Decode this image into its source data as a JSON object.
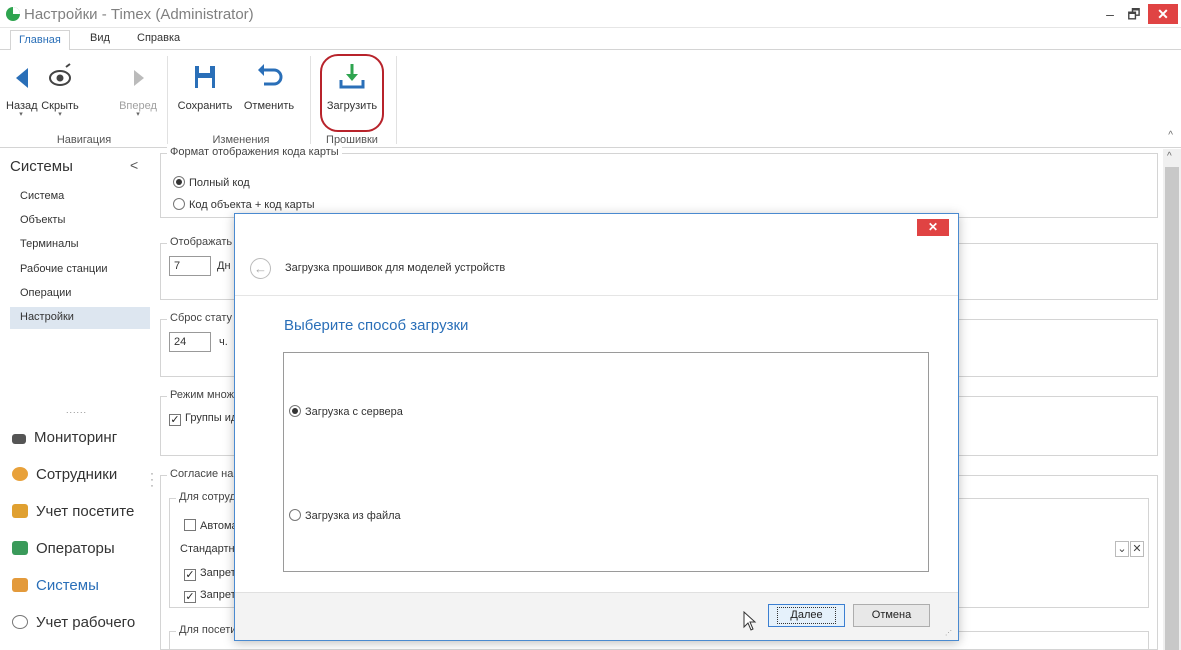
{
  "window": {
    "title": "Настройки - Timex (Administrator)"
  },
  "ribbon_tabs": [
    "Главная",
    "Вид",
    "Справка"
  ],
  "ribbon": {
    "nav": {
      "back": "Назад",
      "hide": "Скрыть",
      "forward": "Вперед",
      "group": "Навигация"
    },
    "changes": {
      "save": "Сохранить",
      "undo": "Отменить",
      "group": "Изменения"
    },
    "firmware": {
      "load": "Загрузить",
      "group": "Прошивки"
    }
  },
  "sidebar": {
    "header": "Системы",
    "items": [
      "Система",
      "Объекты",
      "Терминалы",
      "Рабочие станции",
      "Операции",
      "Настройки"
    ],
    "selected": "Настройки",
    "sections": [
      "Мониторинг",
      "Сотрудники",
      "Учет посетите",
      "Операторы",
      "Системы",
      "Учет рабочего"
    ]
  },
  "main": {
    "card_format": {
      "title": "Формат отображения кода карты",
      "full_code": "Полный код",
      "object_plus_card": "Код объекта + код карты"
    },
    "display": {
      "title": "Отображать",
      "value": "7",
      "unit": "Дн"
    },
    "reset": {
      "title": "Сброс стату",
      "value": "24",
      "unit": "ч."
    },
    "mode": {
      "title": "Режим множ",
      "groups": "Группы ид"
    },
    "consent": {
      "title": "Согласие на",
      "employees": "Для сотруд",
      "auto": "Автомат",
      "standard": "Стандартн",
      "ban1": "Запрет",
      "ban2": "Запрет",
      "visitors": "Для посети"
    }
  },
  "dialog": {
    "title": "Загрузка прошивок для моделей устройств",
    "heading": "Выберите способ загрузки",
    "options": [
      "Загрузка с сервера",
      "Загрузка из файла"
    ],
    "selected_option": "Загрузка с сервера",
    "next": "Далее",
    "cancel": "Отмена"
  },
  "colors": {
    "accent": "#2a6fb8",
    "close": "#e04343",
    "highlight_ring": "#b8232b"
  }
}
